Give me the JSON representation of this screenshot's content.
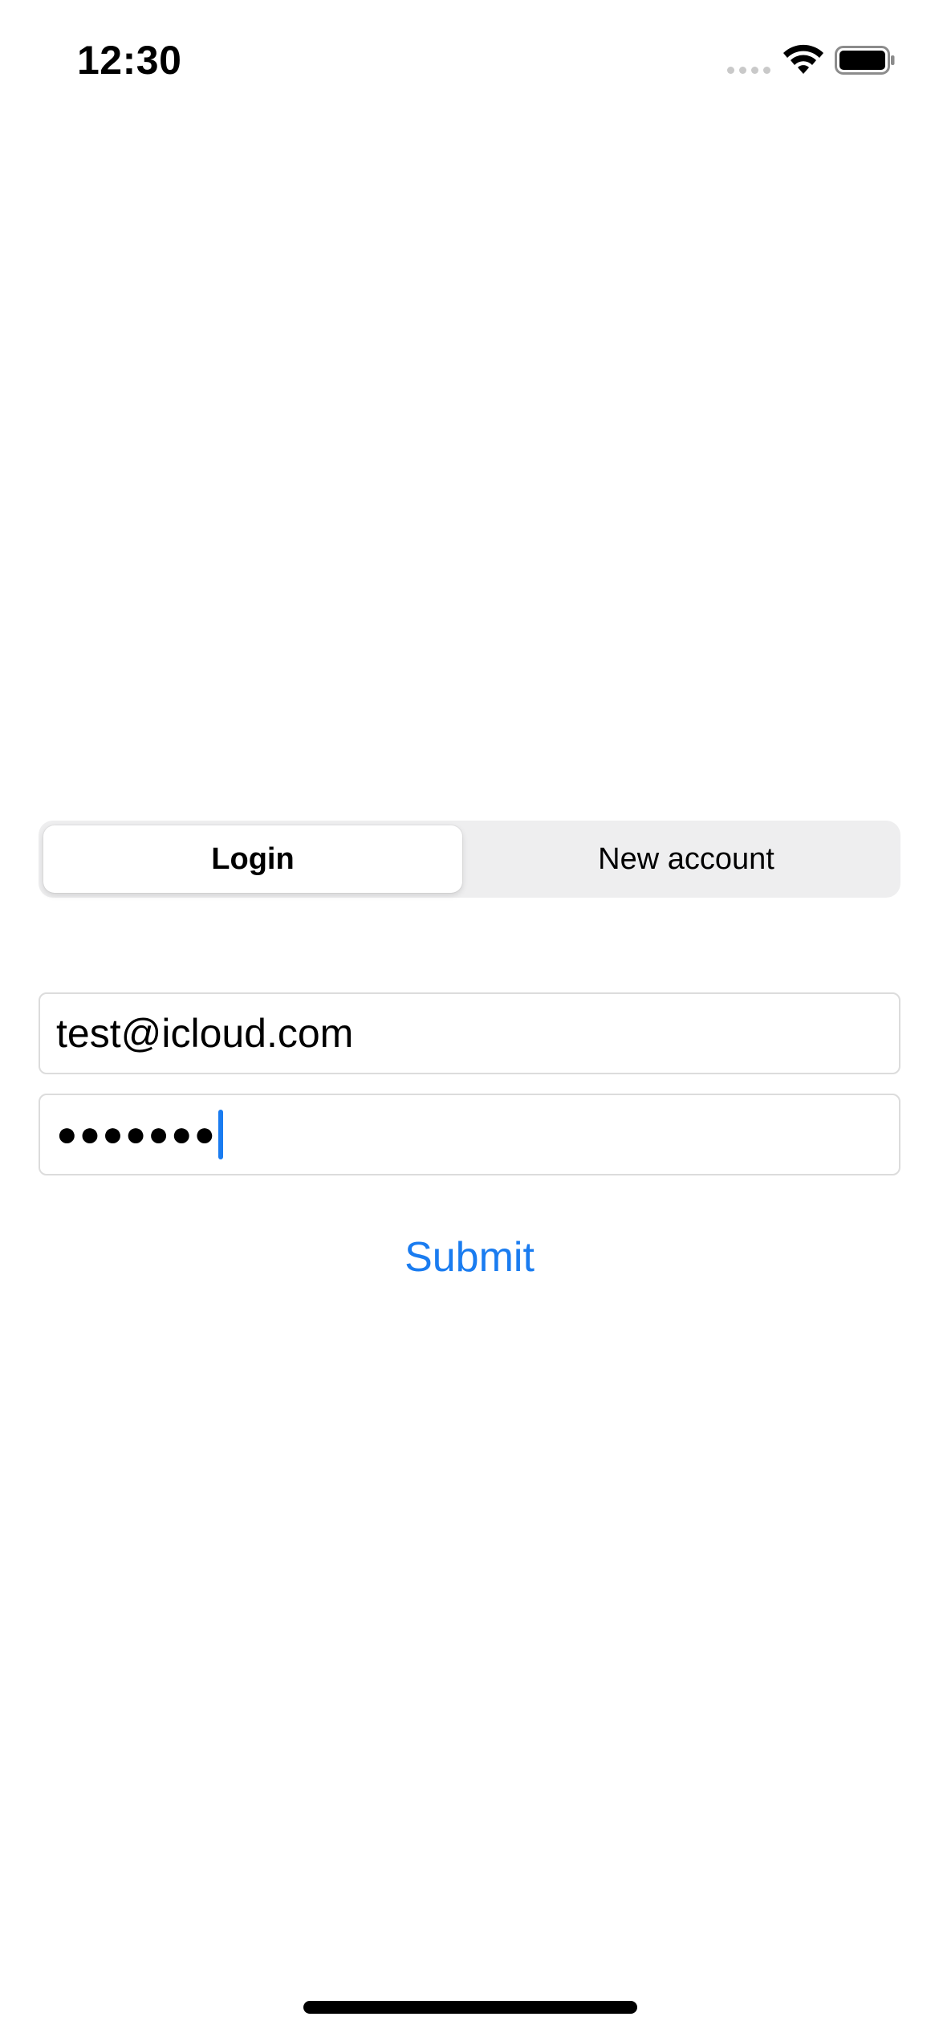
{
  "status_bar": {
    "time": "12:30",
    "signal_icon": "cellular-signal-icon",
    "wifi_icon": "wifi-icon",
    "battery_icon": "battery-icon"
  },
  "segmented_control": {
    "items": [
      {
        "label": "Login",
        "selected": true
      },
      {
        "label": "New account",
        "selected": false
      }
    ]
  },
  "form": {
    "email_value": "test@icloud.com",
    "password_masked": "●●●●●●●",
    "submit_label": "Submit"
  },
  "colors": {
    "accent": "#1a7cf0",
    "segmented_background": "#eeeeef",
    "field_border": "#dcdcdc"
  }
}
